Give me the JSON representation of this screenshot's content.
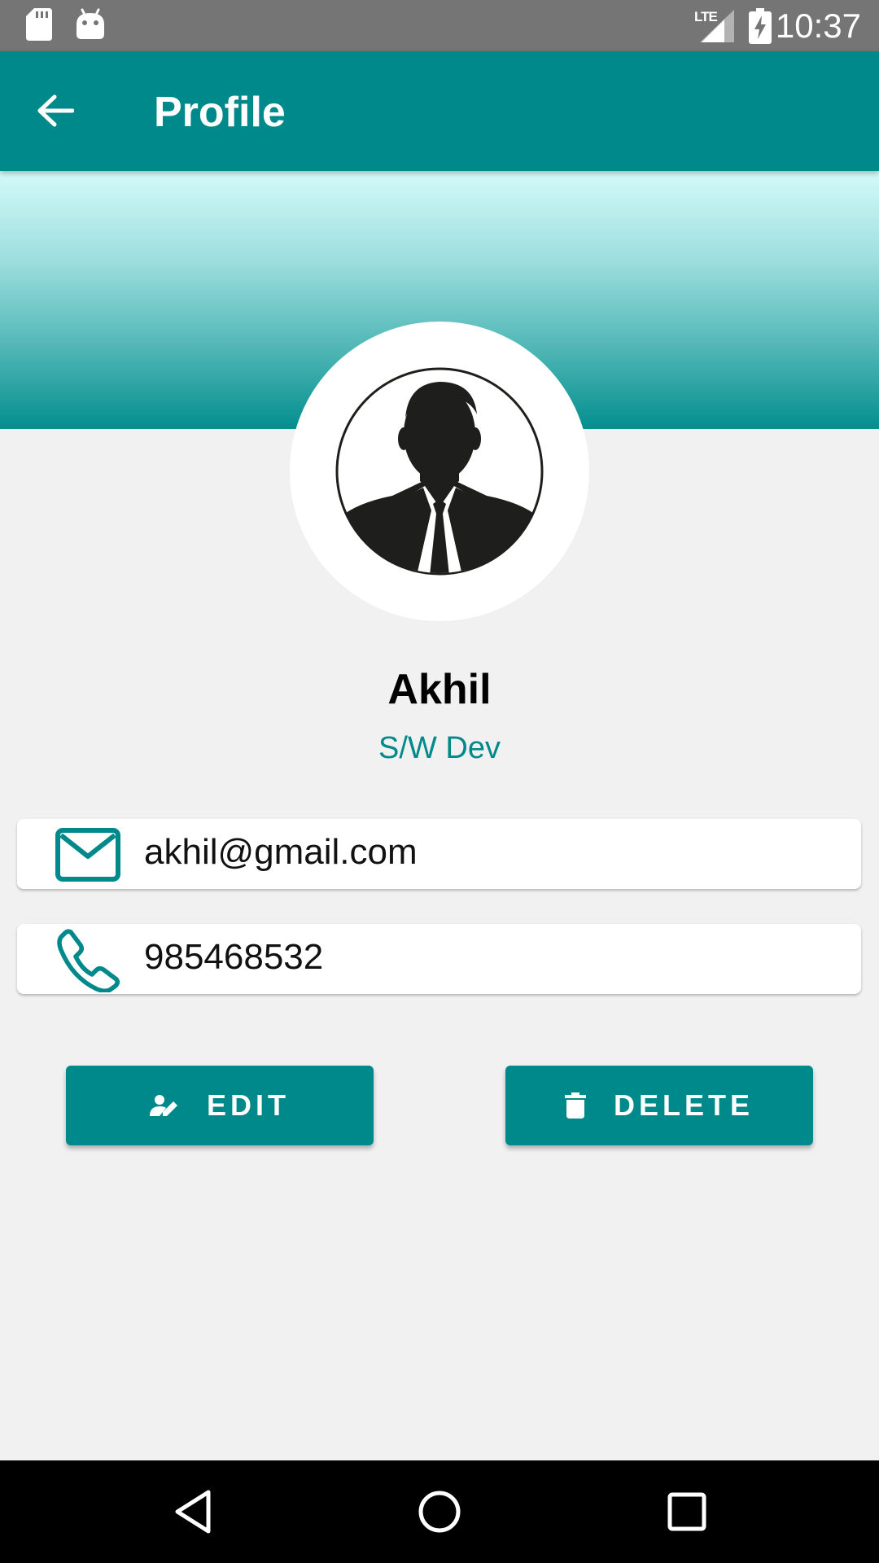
{
  "status_bar": {
    "time": "10:37",
    "network": "LTE",
    "icons": [
      "sd-card-icon",
      "android-icon",
      "lte-signal-icon",
      "battery-charging-icon"
    ]
  },
  "app_bar": {
    "title": "Profile",
    "back_icon": "arrow-left-icon"
  },
  "profile": {
    "name": "Akhil",
    "role": "S/W Dev",
    "avatar_icon": "businessman-silhouette-icon"
  },
  "contacts": {
    "email": "akhil@gmail.com",
    "phone": "985468532",
    "email_icon": "mail-icon",
    "phone_icon": "phone-icon"
  },
  "actions": {
    "edit_label": "EDIT",
    "delete_label": "DELETE",
    "edit_icon": "edit-person-icon",
    "delete_icon": "trash-icon"
  },
  "nav_bar": {
    "icons": [
      "back-triangle-icon",
      "home-circle-icon",
      "recents-square-icon"
    ]
  },
  "colors": {
    "primary": "#00898a",
    "status_bar": "#757575",
    "background": "#f1f1f1",
    "text": "#000000"
  }
}
